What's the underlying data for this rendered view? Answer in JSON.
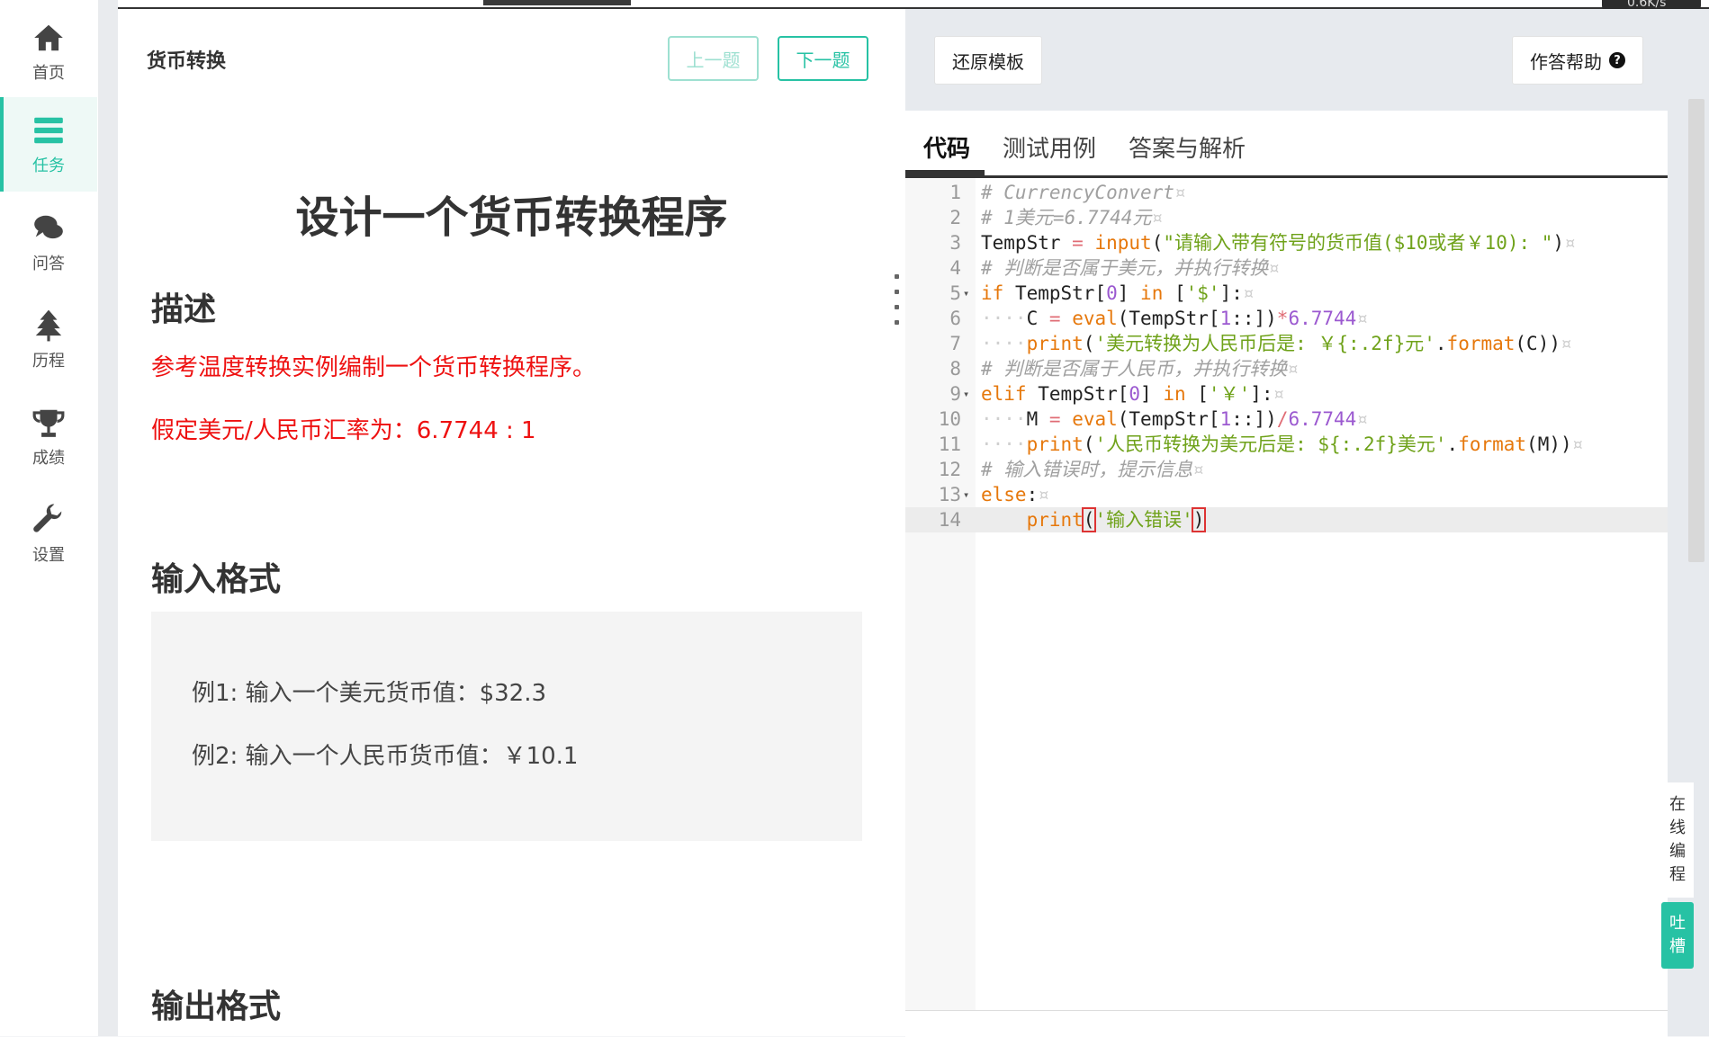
{
  "sidebar": {
    "items": [
      {
        "label": "首页",
        "icon": "home-icon"
      },
      {
        "label": "任务",
        "icon": "tasks-icon",
        "active": true
      },
      {
        "label": "问答",
        "icon": "chat-icon"
      },
      {
        "label": "历程",
        "icon": "tree-icon"
      },
      {
        "label": "成绩",
        "icon": "trophy-icon"
      },
      {
        "label": "设置",
        "icon": "wrench-icon"
      }
    ]
  },
  "status": {
    "net_speed": "0.6K/s"
  },
  "problem": {
    "header_title": "货币转换",
    "prev_label": "上一题",
    "next_label": "下一题",
    "main_title": "设计一个货币转换程序",
    "desc_heading": "描述",
    "desc_line1": "参考温度转换实例编制一个货币转换程序。",
    "desc_line2": "假定美元/人民币汇率为：6.7744 : 1",
    "input_heading": "输入格式",
    "examples": [
      "例1: 输入一个美元货币值：$32.3",
      "例2: 输入一个人民币货币值：￥10.1"
    ],
    "output_heading": "输出格式"
  },
  "editor": {
    "reset_label": "还原模板",
    "help_label": "作答帮助",
    "tabs": [
      "代码",
      "测试用例",
      "答案与解析"
    ],
    "line_numbers": [
      "1",
      "2",
      "3",
      "4",
      "5",
      "6",
      "7",
      "8",
      "9",
      "10",
      "11",
      "12",
      "13",
      "14"
    ]
  },
  "side_widgets": {
    "online_label": [
      "在",
      "线",
      "编",
      "程"
    ],
    "tucao_label": [
      "吐",
      "槽"
    ]
  },
  "colors": {
    "accent": "#27c2a4",
    "alert_red": "#ee1111"
  }
}
